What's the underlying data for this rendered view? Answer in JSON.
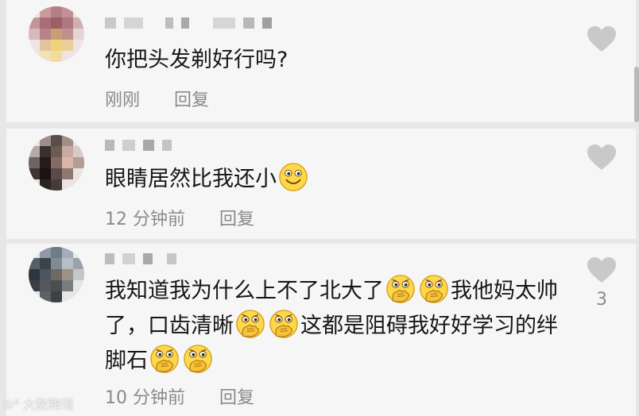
{
  "comments": [
    {
      "text": "你把头发剃好行吗?",
      "time": "刚刚",
      "reply_label": "回复",
      "likes": ""
    },
    {
      "text": "眼睛居然比我还小",
      "time": "12 分钟前",
      "reply_label": "回复",
      "likes": ""
    },
    {
      "text_part1": "我知道我为什么上不了北大了",
      "text_part2": "我他妈太帅了，口齿清晰",
      "text_part3": "这都是阻碍我好好学习的绊脚石",
      "time": "10 分钟前",
      "reply_label": "回复",
      "likes": "3"
    }
  ],
  "icons": {
    "like": "heart-icon",
    "emoji_smile": "smiling-face-icon",
    "emoji_cover_mouth": "hand-over-mouth-face-icon"
  },
  "colors": {
    "card_background": "#f6f6f6",
    "separator": "#e7e7e7",
    "text": "#161616",
    "meta_text": "#8a8a8a",
    "heart": "#c9c9c9",
    "emoji_yellow": "#ffd84a"
  },
  "watermark": "大数跨境"
}
